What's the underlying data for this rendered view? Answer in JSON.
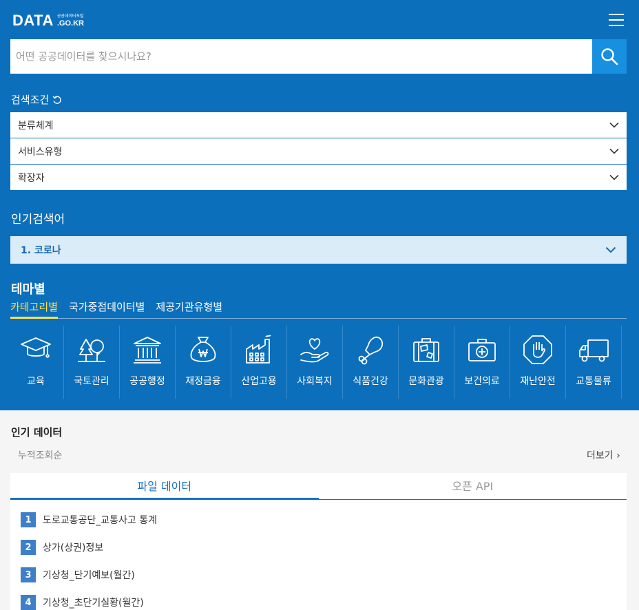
{
  "header": {
    "logo_main": "DATA",
    "logo_small": "공공데이터포털",
    "logo_domain": ".GO.KR"
  },
  "search": {
    "placeholder": "어떤 공공데이터를 찾으시나요?"
  },
  "conditions": {
    "title": "검색조건",
    "selects": [
      "분류체계",
      "서비스유형",
      "확장자"
    ]
  },
  "popular_search": {
    "title": "인기검색어",
    "current": "1. 코로나"
  },
  "theme": {
    "title": "테마별",
    "tabs": [
      "카테고리별",
      "국가중점데이터별",
      "제공기관유형별"
    ],
    "active_tab": 0,
    "active_color": "#ffe14d",
    "categories": [
      {
        "label": "교육",
        "icon": "graduation-cap-icon"
      },
      {
        "label": "국토관리",
        "icon": "trees-icon"
      },
      {
        "label": "공공행정",
        "icon": "government-building-icon"
      },
      {
        "label": "재정금융",
        "icon": "money-bag-icon"
      },
      {
        "label": "산업고용",
        "icon": "factory-icon"
      },
      {
        "label": "사회복지",
        "icon": "heart-hand-icon"
      },
      {
        "label": "식품건강",
        "icon": "drumstick-icon"
      },
      {
        "label": "문화관광",
        "icon": "suitcase-icon"
      },
      {
        "label": "보건의료",
        "icon": "first-aid-kit-icon"
      },
      {
        "label": "재난안전",
        "icon": "stop-hand-icon"
      },
      {
        "label": "교통물류",
        "icon": "truck-icon"
      }
    ]
  },
  "popular_data": {
    "title": "인기 데이터",
    "sort": "누적조회순",
    "more": "더보기",
    "tabs": [
      "파일 데이터",
      "오픈 API"
    ],
    "active_tab": 0,
    "items": [
      {
        "rank": "1",
        "title": "도로교통공단_교통사고 통계"
      },
      {
        "rank": "2",
        "title": "상가(상권)정보"
      },
      {
        "rank": "3",
        "title": "기상청_단기예보(월간)"
      },
      {
        "rank": "4",
        "title": "기상청_초단기실황(월간)"
      }
    ]
  },
  "colors": {
    "brand_blue": "#0c6fbc",
    "search_button": "#1890e0",
    "rank_badge": "#3d7fc9"
  }
}
